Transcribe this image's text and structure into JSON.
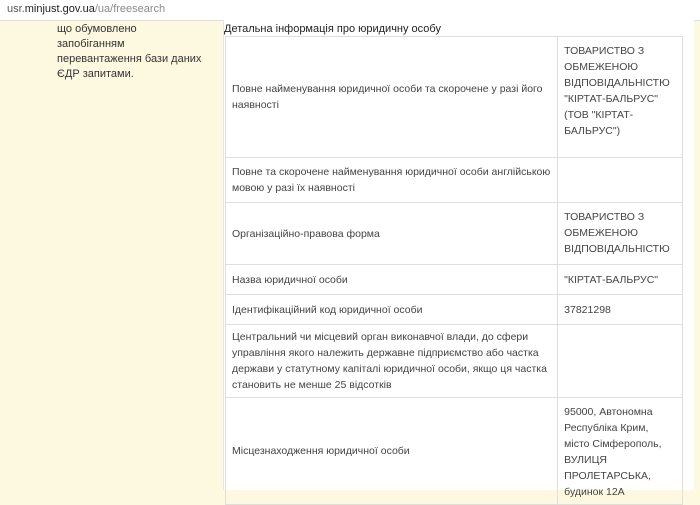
{
  "address_bar": {
    "host_prefix": "usr.",
    "host_domain": "minjust.gov.ua",
    "path": "/ua/freesearch"
  },
  "sidebar": {
    "lines": [
      "що обумовлено запобіганням",
      "перевантаження бази даних",
      "ЄДР запитами."
    ]
  },
  "main": {
    "caption": "Детальна інформація про юридичну особу",
    "rows": [
      {
        "label": "Повне найменування юридичної особи та скорочене у разі його наявності",
        "value": "ТОВАРИСТВО З ОБМЕЖЕНОЮ ВІДПОВІДАЛЬНІСТЮ \"КІРТАТ-БАЛЬРУС\" (ТОВ \"КІРТАТ-БАЛЬРУС\")"
      },
      {
        "label": "Повне та скорочене найменування юридичної особи англійською мовою у разі їх наявності",
        "value": ""
      },
      {
        "label": "Організаційно-правова форма",
        "value": "ТОВАРИСТВО З ОБМЕЖЕНОЮ ВІДПОВІДАЛЬНІСТЮ"
      },
      {
        "label": "Назва юридичної особи",
        "value": "\"КІРТАТ-БАЛЬРУС\""
      },
      {
        "label": "Ідентифікаційний код юридичної особи",
        "value": "37821298"
      },
      {
        "label": "Центральний чи місцевий орган виконавчої влади, до сфери управління якого належить державне підприємство або частка держави у статутному капіталі юридичної особи, якщо ця частка становить не менше 25 відсотків",
        "value": ""
      },
      {
        "label": "Місцезнаходження юридичної особи",
        "value": "95000, Автономна Республіка Крим, місто Сімферополь, ВУЛИЦЯ ПРОЛЕТАРСЬКА, будинок 12А"
      }
    ]
  }
}
